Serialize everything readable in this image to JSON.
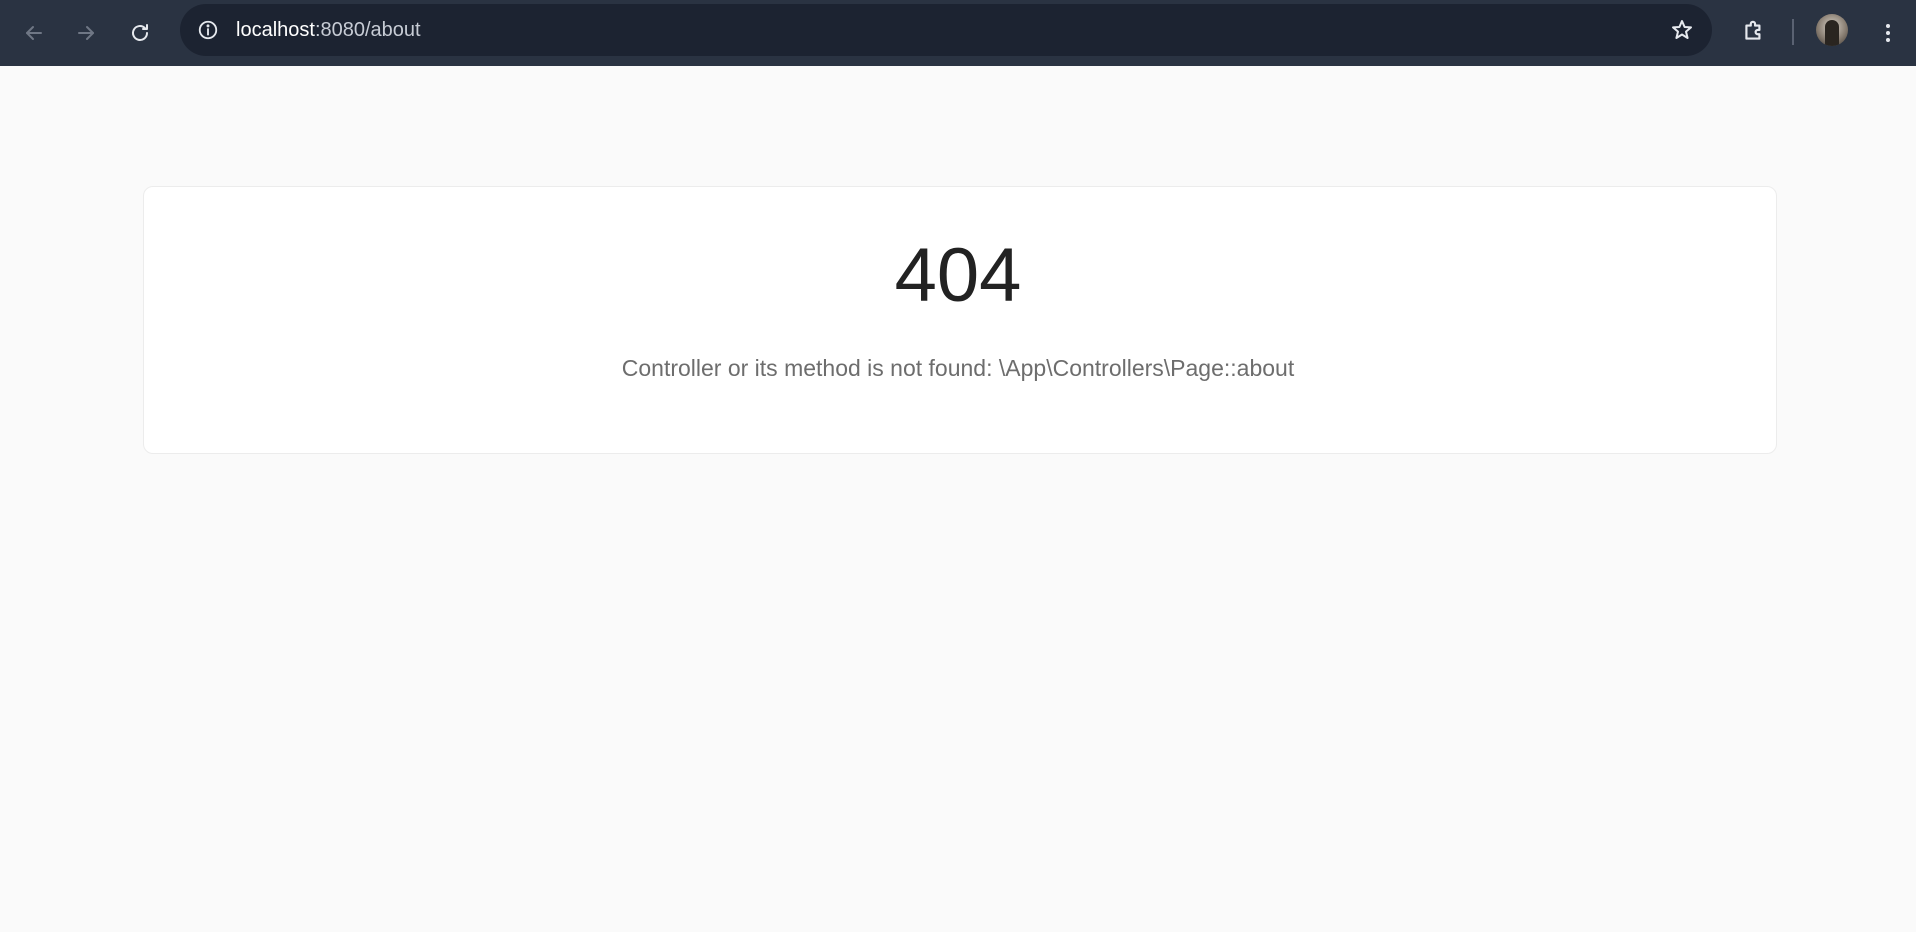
{
  "browser": {
    "url_host": "localhost",
    "url_rest": ":8080/about",
    "back_icon": "arrow-left-icon",
    "forward_icon": "arrow-right-icon",
    "reload_icon": "reload-icon",
    "site_info_icon": "info-icon",
    "bookmark_icon": "star-icon",
    "extensions_icon": "puzzle-icon",
    "menu_icon": "kebab-menu-icon",
    "colors": {
      "toolbar_bg": "#2a3342",
      "omnibox_bg": "#1c2331",
      "page_bg": "#fafafa"
    }
  },
  "error_page": {
    "code": "404",
    "message": "Controller or its method is not found: \\App\\Controllers\\Page::about"
  }
}
